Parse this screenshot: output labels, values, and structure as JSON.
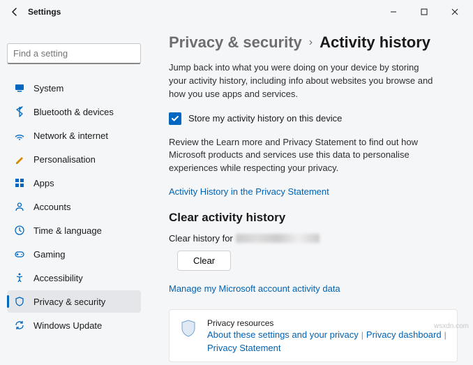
{
  "window": {
    "title": "Settings",
    "minimize": "–",
    "maximize": "▢",
    "close": "✕"
  },
  "search": {
    "placeholder": "Find a setting"
  },
  "sidebar": {
    "items": [
      {
        "label": "System"
      },
      {
        "label": "Bluetooth & devices"
      },
      {
        "label": "Network & internet"
      },
      {
        "label": "Personalisation"
      },
      {
        "label": "Apps"
      },
      {
        "label": "Accounts"
      },
      {
        "label": "Time & language"
      },
      {
        "label": "Gaming"
      },
      {
        "label": "Accessibility"
      },
      {
        "label": "Privacy & security"
      },
      {
        "label": "Windows Update"
      }
    ]
  },
  "breadcrumb": {
    "parent": "Privacy & security",
    "sep": "›",
    "current": "Activity history"
  },
  "intro": "Jump back into what you were doing on your device by storing your activity history, including info about websites you browse and how you use apps and services.",
  "checkbox": {
    "label": "Store my activity history on this device",
    "checked": true
  },
  "review": "Review the Learn more and Privacy Statement to find out how Microsoft products and services use this data to personalise experiences while respecting your privacy.",
  "link_privacy_statement": "Activity History in the Privacy Statement",
  "clear_heading": "Clear activity history",
  "clear_line_prefix": "Clear history for",
  "clear_button": "Clear",
  "link_manage": "Manage my Microsoft account activity data",
  "card": {
    "title": "Privacy resources",
    "link1": "About these settings and your privacy",
    "link2": "Privacy dashboard",
    "link3": "Privacy Statement",
    "sep": "|"
  },
  "watermark": "wsxdn.com"
}
